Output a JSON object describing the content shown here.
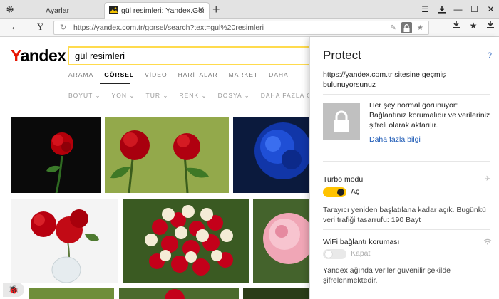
{
  "tabs": {
    "settings": {
      "label": "Ayarlar"
    },
    "active": {
      "label": "gül resimleri: Yandex.Görsel"
    }
  },
  "icons": {
    "settings": "gear-icon",
    "tab_favicon": "yandex-images-favicon",
    "tab_close": "close-icon",
    "new_tab": "plus-icon",
    "menu": "hamburger-icon",
    "downloads": "download-icon",
    "minimize": "minimize-icon",
    "maximize": "maximize-icon",
    "close_window": "close-window-icon",
    "back": "arrow-left-icon",
    "yandex_browser": "yandex-y-icon",
    "reload": "reload-icon",
    "protect": "lock-icon",
    "favorite": "star-icon",
    "turbo": "rocket-icon",
    "wifi": "wifi-icon",
    "bug_report": "ladybug-icon"
  },
  "address_bar": {
    "url": "https://yandex.com.tr/gorsel/search?text=gul%20resimleri"
  },
  "page": {
    "logo": {
      "first": "Y",
      "rest": "andex"
    },
    "search": {
      "value": "gül resimleri"
    },
    "nav_tabs": [
      "ARAMA",
      "GÖRSEL",
      "VİDEO",
      "HARİTALAR",
      "MARKET",
      "DAHA"
    ],
    "filters": [
      "BOYUT ⌄",
      "YÖN ⌄",
      "TÜR ⌄",
      "RENK ⌄",
      "DOSYA ⌄",
      "DAHA FAZLA GÖSTER"
    ]
  },
  "protect": {
    "title": "Protect",
    "help": "?",
    "site_text": "https://yandex.com.tr sitesine geçmiş bulunuyorsunuz",
    "status_text": "Her şey normal görünüyor: Bağlantınız korumalıdır ve verileriniz şifreli olarak aktarılır.",
    "more_link": "Daha fazla bilgi",
    "turbo": {
      "title": "Turbo modu",
      "state": "Aç",
      "enabled": true,
      "description": "Tarayıcı yeniden başlatılana kadar açık. Bugünkü veri trafiği tasarrufu: 190 Bayt"
    },
    "wifi": {
      "title": "WiFi bağlantı koruması",
      "state": "Kapat",
      "enabled": false,
      "description": "Yandex ağında veriler güvenilir şekilde şifrelenmektedir."
    }
  },
  "colors": {
    "accent_yellow": "#ffdb4d",
    "toggle_on": "#ffc300",
    "link": "#1a58b5",
    "logo_red": "#e61400"
  }
}
